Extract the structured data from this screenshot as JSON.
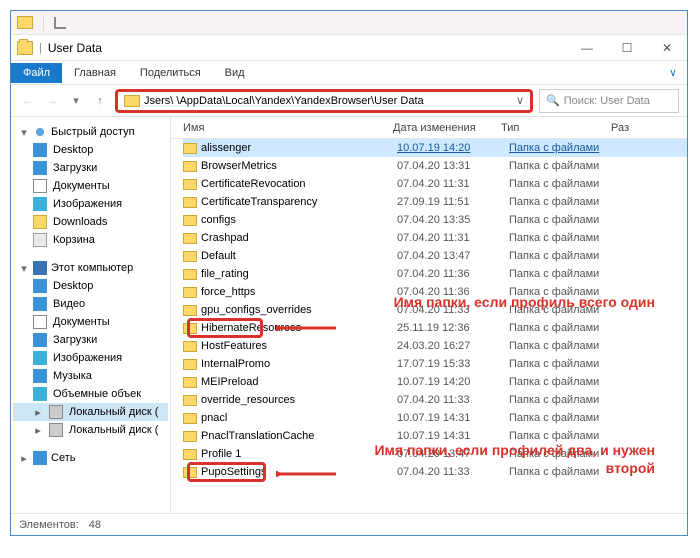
{
  "window": {
    "title": "User Data"
  },
  "ribbon": {
    "file": "Файл",
    "tabs": [
      "Главная",
      "Поделиться",
      "Вид"
    ]
  },
  "address": {
    "path": "Jsers\\         \\AppData\\Local\\Yandex\\YandexBrowser\\User Data",
    "search_placeholder": "Поиск: User Data"
  },
  "columns": {
    "name": "Имя",
    "date": "Дата изменения",
    "type": "Тип",
    "size": "Раз"
  },
  "sidebar": {
    "quick": {
      "label": "Быстрый доступ",
      "items": [
        "Desktop",
        "Загрузки",
        "Документы",
        "Изображения",
        "Downloads",
        "Корзина"
      ]
    },
    "pc": {
      "label": "Этот компьютер",
      "items": [
        "Desktop",
        "Видео",
        "Документы",
        "Загрузки",
        "Изображения",
        "Музыка",
        "Объемные объек",
        "Локальный диск (",
        "Локальный диск ("
      ]
    },
    "net": {
      "label": "Сеть"
    }
  },
  "rows": [
    {
      "n": "alissenger",
      "d": "10.07.19 14:20",
      "t": "Папка с файлами",
      "sel": true
    },
    {
      "n": "BrowserMetrics",
      "d": "07.04.20 13:31",
      "t": "Папка с файлами"
    },
    {
      "n": "CertificateRevocation",
      "d": "07.04.20 11:31",
      "t": "Папка с файлами"
    },
    {
      "n": "CertificateTransparency",
      "d": "27.09.19 11:51",
      "t": "Папка с файлами"
    },
    {
      "n": "configs",
      "d": "07.04.20 13:35",
      "t": "Папка с файлами"
    },
    {
      "n": "Crashpad",
      "d": "07.04.20 11:31",
      "t": "Папка с файлами"
    },
    {
      "n": "Default",
      "d": "07.04.20 13:47",
      "t": "Папка с файлами"
    },
    {
      "n": "file_rating",
      "d": "07.04.20 11:36",
      "t": "Папка с файлами"
    },
    {
      "n": "force_https",
      "d": "07.04.20 11:36",
      "t": "Папка с файлами"
    },
    {
      "n": "gpu_configs_overrides",
      "d": "07.04.20 11:33",
      "t": "Папка с файлами"
    },
    {
      "n": "HibernateResources",
      "d": "25.11.19 12:36",
      "t": "Папка с файлами"
    },
    {
      "n": "HostFeatures",
      "d": "24.03.20 16:27",
      "t": "Папка с файлами"
    },
    {
      "n": "InternalPromo",
      "d": "17.07.19 15:33",
      "t": "Папка с файлами"
    },
    {
      "n": "MEIPreload",
      "d": "10.07.19 14:20",
      "t": "Папка с файлами"
    },
    {
      "n": "override_resources",
      "d": "07.04.20 11:33",
      "t": "Папка с файлами"
    },
    {
      "n": "pnacl",
      "d": "10.07.19 14:31",
      "t": "Папка с файлами"
    },
    {
      "n": "PnaclTranslationCache",
      "d": "10.07.19 14:31",
      "t": "Папка с файлами"
    },
    {
      "n": "Profile 1",
      "d": "07.04.20 13:47",
      "t": "Папка с файлами"
    },
    {
      "n": "PupoSettings",
      "d": "07.04.20 11:33",
      "t": "Папка с файлами"
    }
  ],
  "status": {
    "count_label": "Элементов:",
    "count": "48"
  },
  "annotations": {
    "a1": "Имя папки, если профиль всего один",
    "a2": "Имя папки, если профилей два, и нужен второй"
  }
}
